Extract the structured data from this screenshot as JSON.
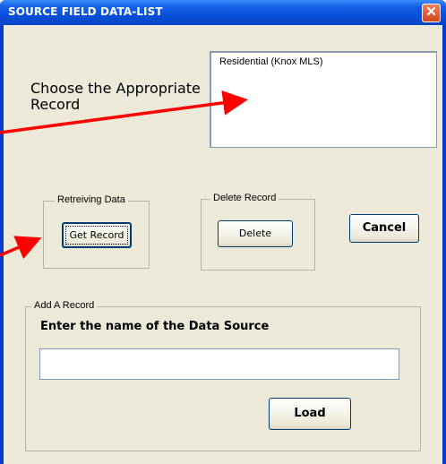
{
  "window": {
    "title": "SOURCE FIELD DATA-LIST",
    "close_symbol": "✕"
  },
  "choose": {
    "label": "Choose the Appropriate Record"
  },
  "record_list": {
    "items": [
      "Residential (Knox MLS)"
    ]
  },
  "retrieving": {
    "legend": "Retreiving Data",
    "button_label": "Get Record"
  },
  "delete": {
    "legend": "Delete Record",
    "button_label": "Delete"
  },
  "cancel": {
    "button_label": "Cancel"
  },
  "add_record": {
    "legend": "Add A Record",
    "prompt": "Enter the name of the Data Source",
    "input_value": "",
    "load_label": "Load"
  },
  "colors": {
    "titlebar": "#0a50dc",
    "dialog_bg": "#ece9d8",
    "arrow": "#ff0000"
  },
  "icons": [
    "close-icon",
    "arrow-annotation"
  ]
}
